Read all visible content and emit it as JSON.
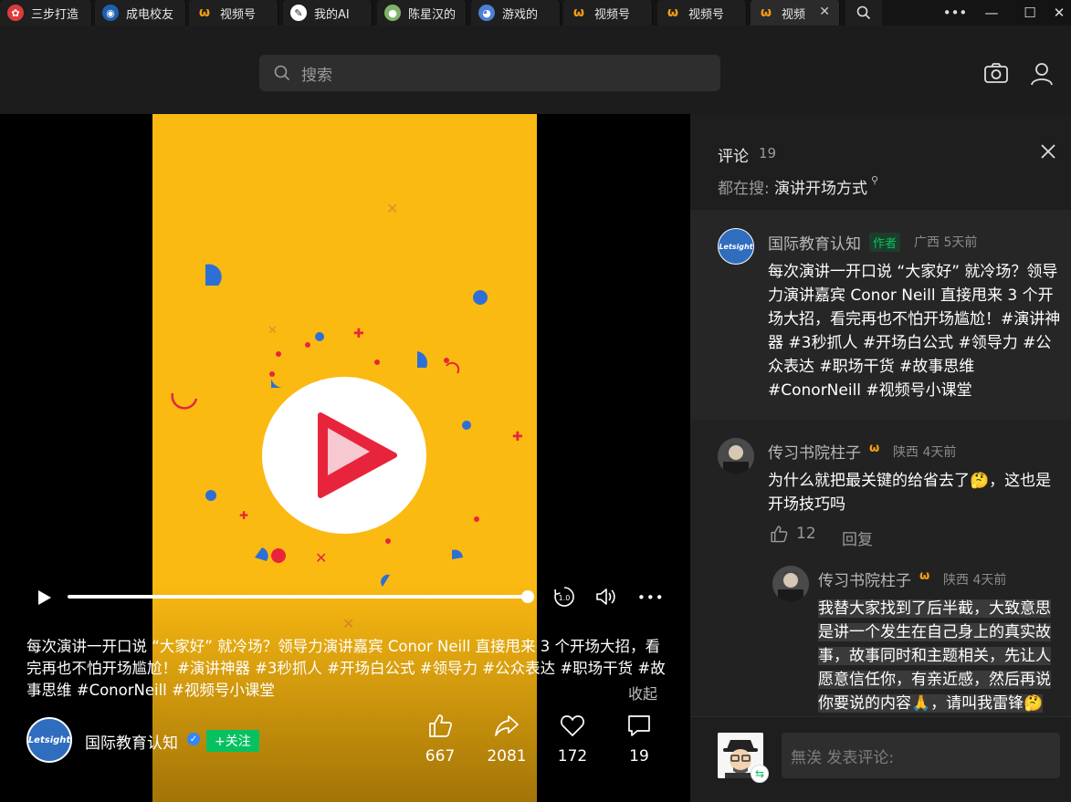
{
  "tabs": [
    {
      "label": "三步打造",
      "icon": "bilibili-icon"
    },
    {
      "label": "成电校友",
      "icon": "school-icon"
    },
    {
      "label": "视频号",
      "icon": "channels-icon"
    },
    {
      "label": "我的AI",
      "icon": "feather-icon"
    },
    {
      "label": "陈星汉的",
      "icon": "globe-icon"
    },
    {
      "label": "游戏的",
      "icon": "game-icon"
    },
    {
      "label": "视频号",
      "icon": "channels-icon"
    },
    {
      "label": "视频号",
      "icon": "channels-icon"
    },
    {
      "label": "视频",
      "icon": "channels-icon",
      "active": true
    }
  ],
  "search": {
    "placeholder": "搜索"
  },
  "video": {
    "description": "每次演讲一开口说 “大家好” 就冷场？领导力演讲嘉宾 Conor Neill 直接甩来 3 个开场大招，看完再也不怕开场尴尬！#演讲神器 #3秒抓人 #开场白公式 #领导力 #公众表达 #职场干货 #故事思维 #ConorNeill #视频号小课堂",
    "collapse_label": "收起",
    "speed_label": "1.0",
    "progress": 0.98,
    "author": {
      "name": "国际教育认知",
      "avatar_text": "Letsight"
    },
    "follow_label": "+关注",
    "actions": {
      "like": "667",
      "share": "2081",
      "favorite": "172",
      "comment": "19"
    }
  },
  "comments_panel": {
    "title": "评论",
    "count": "19",
    "search_label": "都在搜:",
    "search_term": "演讲开场方式",
    "author_comment": {
      "name": "国际教育认知",
      "tag": "作者",
      "meta": "广西 5天前",
      "text": "每次演讲一开口说 “大家好” 就冷场？领导力演讲嘉宾 Conor Neill 直接甩来 3 个开场大招，看完再也不怕开场尴尬！#演讲神器 #3秒抓人 #开场白公式 #领导力 #公众表达 #职场干货 #故事思维 #ConorNeill #视频号小课堂"
    },
    "comment1": {
      "name": "传习书院柱子",
      "meta": "陕西 4天前",
      "text": "为什么就把最关键的给省去了🤔，这也是开场技巧吗",
      "likes": "12",
      "reply_label": "回复"
    },
    "reply1": {
      "name": "传习书院柱子",
      "meta": "陕西 4天前",
      "text": "我替大家找到了后半截，大致意思是讲一个发生在自己身上的真实故事，故事同时和主题相关，先让人愿意信任你，有亲近感，然后再说你要说的内容🙏，请叫我雷锋🤔"
    },
    "input_placeholder": "無涘 发表评论:"
  },
  "colors": {
    "accent": "#07c160",
    "poster": "#fbba12",
    "play": "#e8243c"
  }
}
